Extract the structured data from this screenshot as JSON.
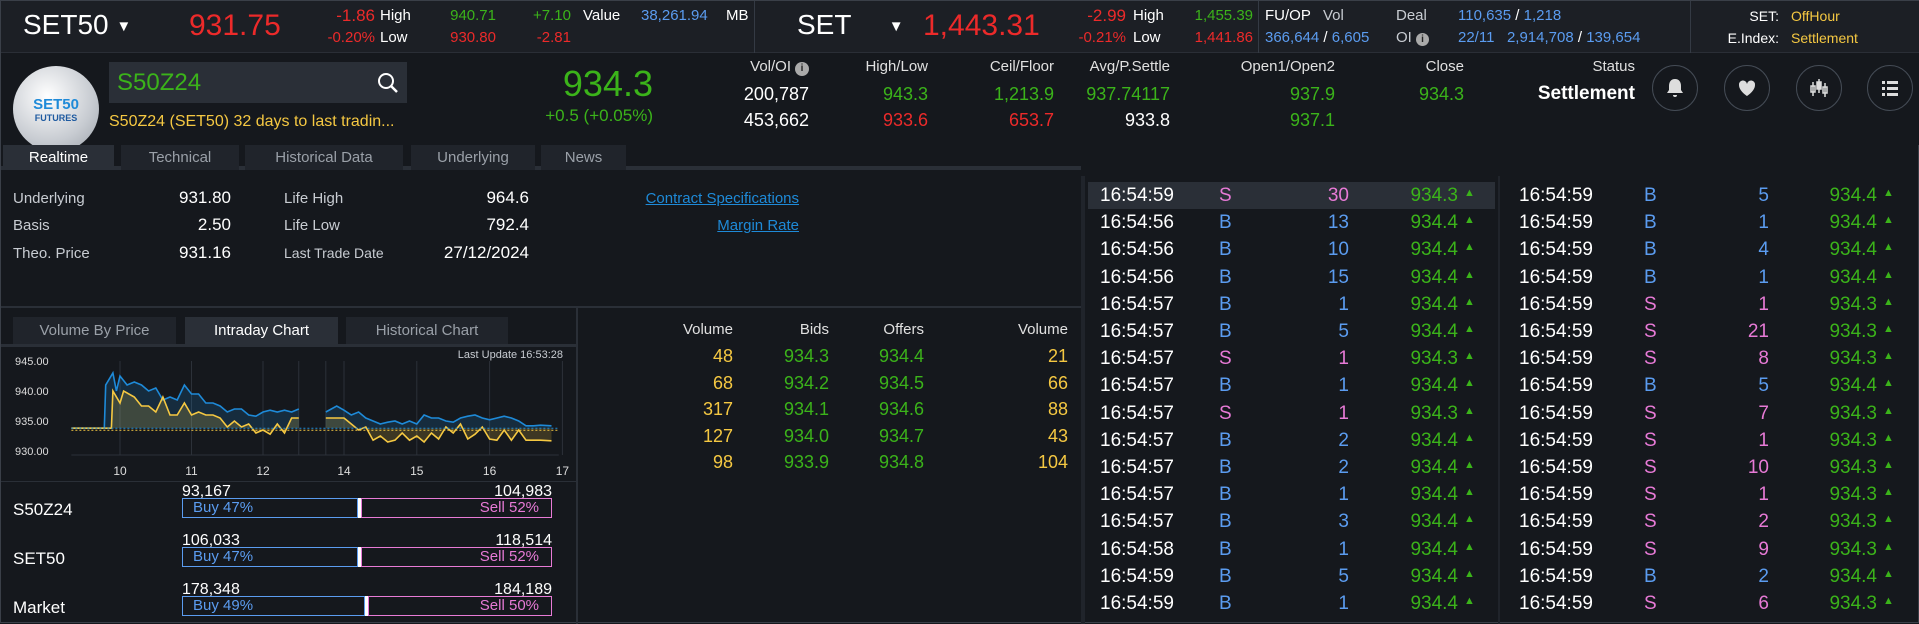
{
  "topbar": {
    "set50": {
      "name": "SET50",
      "last": "931.75",
      "change": "-1.86",
      "pct": "-0.20%",
      "high_label": "High",
      "low_label": "Low",
      "high": "940.71",
      "low": "930.80",
      "high_chg": "+7.10",
      "low_chg": "-2.81",
      "value_label": "Value",
      "value": "38,261.94",
      "unit": "MB"
    },
    "set": {
      "name": "SET",
      "last": "1,443.31",
      "change": "-2.99",
      "pct": "-0.21%",
      "high_label": "High",
      "low_label": "Low",
      "high": "1,455.39",
      "low": "1,441.86"
    },
    "fuop": {
      "label": "FU/OP",
      "vol_label": "Vol",
      "vol": "366,644",
      "vol2": "6,605",
      "deal_label": "Deal",
      "deal": "110,635",
      "deal2": "1,218",
      "oi_label": "OI",
      "oi_date": "22/11",
      "oi": "2,914,708",
      "oi2": "139,654",
      "sep": "/"
    },
    "status": {
      "set_label": "SET:",
      "set_value": "OffHour",
      "eindex_label": "E.Index:",
      "eindex_value": "Settlement"
    }
  },
  "header": {
    "logo_line1": "SET50",
    "logo_line2": "FUTURES",
    "search_value": "S50Z24",
    "description": "S50Z24 (SET50) 32 days to last tradin...",
    "last": "934.3",
    "change": "+0.5 (+0.05%)",
    "columns": [
      {
        "label": "Vol/OI",
        "v1": "200,787",
        "v2": "453,662"
      },
      {
        "label": "High/Low",
        "v1": "943.3",
        "v2": "933.6"
      },
      {
        "label": "Ceil/Floor",
        "v1": "1,213.9",
        "v2": "653.7"
      },
      {
        "label": "Avg/P.Settle",
        "v1": "937.74117",
        "v2": "933.8"
      },
      {
        "label": "Open1/Open2",
        "v1": "937.9",
        "v2": "937.1"
      },
      {
        "label": "Close",
        "v1": "934.3",
        "v2": ""
      },
      {
        "label": "Status",
        "v1": "Settlement",
        "v2": ""
      }
    ],
    "icons": [
      "bell-icon",
      "heart-icon",
      "candlestick-icon",
      "list-icon"
    ]
  },
  "tabs": [
    "Realtime",
    "Technical",
    "Historical Data",
    "Underlying",
    "News"
  ],
  "info": {
    "underlying_label": "Underlying",
    "underlying": "931.80",
    "basis_label": "Basis",
    "basis": "2.50",
    "theo_label": "Theo. Price",
    "theo": "931.16",
    "life_high_label": "Life High",
    "life_high": "964.6",
    "life_low_label": "Life Low",
    "life_low": "792.4",
    "last_trade_label": "Last Trade Date",
    "last_trade": "27/12/2024",
    "contract_spec": "Contract Specifications",
    "margin_rate": "Margin Rate"
  },
  "chart_tabs": [
    "Volume By Price",
    "Intraday Chart",
    "Historical Chart"
  ],
  "chart_data": {
    "type": "line",
    "last_update": "Last Update 16:53:28",
    "ylim": [
      930,
      945
    ],
    "yticks": [
      "945.00",
      "940.00",
      "935.00",
      "930.00"
    ],
    "xticks": [
      "10",
      "11",
      "12",
      "14",
      "15",
      "16",
      "17"
    ],
    "reference": 933.8,
    "colors": [
      "#1e8ad8",
      "#f5c842"
    ],
    "series": [
      {
        "sessions": [
          [
            [
              9.32,
              933.8
            ],
            [
              9.78,
              933.8
            ],
            [
              9.8,
              941
            ],
            [
              9.9,
              943
            ],
            [
              9.95,
              940
            ],
            [
              10.0,
              942.5
            ],
            [
              10.1,
              941
            ],
            [
              10.2,
              941.5
            ],
            [
              10.3,
              941
            ],
            [
              10.4,
              940
            ],
            [
              10.5,
              940.5
            ],
            [
              10.6,
              938.5
            ],
            [
              10.7,
              939
            ],
            [
              10.8,
              938.5
            ],
            [
              10.9,
              941
            ],
            [
              11.0,
              939.5
            ],
            [
              11.1,
              939.5
            ],
            [
              11.2,
              938
            ],
            [
              11.3,
              938
            ],
            [
              11.4,
              937.5
            ],
            [
              11.5,
              936.5
            ],
            [
              11.6,
              937
            ],
            [
              11.7,
              937
            ],
            [
              11.8,
              936
            ],
            [
              11.9,
              935.8
            ],
            [
              12.0,
              936.5
            ],
            [
              12.1,
              936.8
            ],
            [
              12.2,
              936.5
            ],
            [
              12.3,
              936.8
            ],
            [
              12.4,
              936.5
            ],
            [
              12.5,
              937
            ]
          ],
          [
            [
              13.75,
              936.5
            ],
            [
              13.9,
              937.5
            ],
            [
              14.0,
              936.8
            ],
            [
              14.1,
              936
            ],
            [
              14.2,
              936.5
            ],
            [
              14.3,
              935.5
            ],
            [
              14.4,
              935
            ],
            [
              14.5,
              934.5
            ],
            [
              14.6,
              934.8
            ],
            [
              14.7,
              935
            ],
            [
              14.8,
              934.5
            ],
            [
              14.9,
              935
            ],
            [
              15.0,
              934.5
            ],
            [
              15.1,
              936
            ],
            [
              15.2,
              935.5
            ],
            [
              15.3,
              935.5
            ],
            [
              15.4,
              935
            ],
            [
              15.5,
              934.8
            ],
            [
              15.6,
              935.5
            ],
            [
              15.7,
              935.8
            ],
            [
              15.8,
              936
            ],
            [
              15.9,
              935.5
            ],
            [
              16.0,
              935.2
            ],
            [
              16.1,
              935.5
            ],
            [
              16.2,
              935.8
            ],
            [
              16.3,
              935.5
            ],
            [
              16.4,
              935
            ],
            [
              16.5,
              934.2
            ],
            [
              16.6,
              934.2
            ],
            [
              16.7,
              934.3
            ],
            [
              16.85,
              934.2
            ]
          ]
        ]
      },
      {
        "sessions": [
          [
            [
              9.32,
              933.8
            ],
            [
              9.88,
              933.8
            ],
            [
              9.9,
              940
            ],
            [
              10.0,
              938
            ],
            [
              10.05,
              940
            ],
            [
              10.2,
              939
            ],
            [
              10.3,
              937.5
            ],
            [
              10.4,
              937.5
            ],
            [
              10.5,
              936.5
            ],
            [
              10.6,
              939
            ],
            [
              10.7,
              936
            ],
            [
              10.8,
              936
            ],
            [
              10.9,
              938
            ],
            [
              11.0,
              936
            ],
            [
              11.1,
              936.5
            ],
            [
              11.2,
              936
            ],
            [
              11.3,
              936
            ],
            [
              11.4,
              935.5
            ],
            [
              11.5,
              934
            ],
            [
              11.6,
              935
            ],
            [
              11.7,
              934
            ],
            [
              11.8,
              934.5
            ],
            [
              11.9,
              933
            ],
            [
              12.0,
              933.5
            ],
            [
              12.1,
              932.8
            ],
            [
              12.2,
              934.5
            ],
            [
              12.3,
              933
            ],
            [
              12.4,
              935.5
            ],
            [
              12.5,
              935.5
            ]
          ],
          [
            [
              13.75,
              935.5
            ],
            [
              14.0,
              935.5
            ],
            [
              14.1,
              934.5
            ],
            [
              14.2,
              933.5
            ],
            [
              14.3,
              934
            ],
            [
              14.4,
              931.8
            ],
            [
              14.5,
              932.5
            ],
            [
              14.6,
              931.5
            ],
            [
              14.7,
              931.8
            ],
            [
              14.8,
              933
            ],
            [
              14.9,
              931.8
            ],
            [
              15.0,
              932.5
            ],
            [
              15.1,
              931.5
            ],
            [
              15.2,
              933
            ],
            [
              15.3,
              932
            ],
            [
              15.4,
              934
            ],
            [
              15.5,
              933
            ],
            [
              15.6,
              934.5
            ],
            [
              15.7,
              932
            ],
            [
              15.8,
              932.8
            ],
            [
              15.9,
              934
            ],
            [
              16.0,
              932
            ],
            [
              16.1,
              931.8
            ],
            [
              16.2,
              933.5
            ],
            [
              16.3,
              931.8
            ],
            [
              16.4,
              933.5
            ],
            [
              16.5,
              931.8
            ],
            [
              16.7,
              931.8
            ],
            [
              16.85,
              931.7
            ]
          ]
        ]
      }
    ]
  },
  "buysell": [
    {
      "name": "S50Z24",
      "buy_vol": "93,167",
      "sell_vol": "104,983",
      "buy": "Buy 47%",
      "sell": "Sell 52%",
      "buy_pct": 47,
      "sell_pct": 52
    },
    {
      "name": "SET50",
      "buy_vol": "106,033",
      "sell_vol": "118,514",
      "buy": "Buy 47%",
      "sell": "Sell 52%",
      "buy_pct": 47,
      "sell_pct": 52
    },
    {
      "name": "Market",
      "buy_vol": "178,348",
      "sell_vol": "184,189",
      "buy": "Buy 49%",
      "sell": "Sell 50%",
      "buy_pct": 49,
      "sell_pct": 50
    }
  ],
  "bidoffer": {
    "headers": [
      "Volume",
      "Bids",
      "Offers",
      "Volume"
    ],
    "rows": [
      [
        "48",
        "934.3",
        "934.4",
        "21"
      ],
      [
        "68",
        "934.2",
        "934.5",
        "66"
      ],
      [
        "317",
        "934.1",
        "934.6",
        "88"
      ],
      [
        "127",
        "934.0",
        "934.7",
        "43"
      ],
      [
        "98",
        "933.9",
        "934.8",
        "104"
      ]
    ]
  },
  "trades_left": [
    [
      "16:54:59",
      "S",
      "30",
      "934.3"
    ],
    [
      "16:54:56",
      "B",
      "13",
      "934.4"
    ],
    [
      "16:54:56",
      "B",
      "10",
      "934.4"
    ],
    [
      "16:54:56",
      "B",
      "15",
      "934.4"
    ],
    [
      "16:54:57",
      "B",
      "1",
      "934.4"
    ],
    [
      "16:54:57",
      "B",
      "5",
      "934.4"
    ],
    [
      "16:54:57",
      "S",
      "1",
      "934.3"
    ],
    [
      "16:54:57",
      "B",
      "1",
      "934.4"
    ],
    [
      "16:54:57",
      "S",
      "1",
      "934.3"
    ],
    [
      "16:54:57",
      "B",
      "2",
      "934.4"
    ],
    [
      "16:54:57",
      "B",
      "2",
      "934.4"
    ],
    [
      "16:54:57",
      "B",
      "1",
      "934.4"
    ],
    [
      "16:54:57",
      "B",
      "3",
      "934.4"
    ],
    [
      "16:54:58",
      "B",
      "1",
      "934.4"
    ],
    [
      "16:54:59",
      "B",
      "5",
      "934.4"
    ],
    [
      "16:54:59",
      "B",
      "1",
      "934.4"
    ]
  ],
  "trades_right": [
    [
      "16:54:59",
      "B",
      "5",
      "934.4"
    ],
    [
      "16:54:59",
      "B",
      "1",
      "934.4"
    ],
    [
      "16:54:59",
      "B",
      "4",
      "934.4"
    ],
    [
      "16:54:59",
      "B",
      "1",
      "934.4"
    ],
    [
      "16:54:59",
      "S",
      "1",
      "934.3"
    ],
    [
      "16:54:59",
      "S",
      "21",
      "934.3"
    ],
    [
      "16:54:59",
      "S",
      "8",
      "934.3"
    ],
    [
      "16:54:59",
      "B",
      "5",
      "934.4"
    ],
    [
      "16:54:59",
      "S",
      "7",
      "934.3"
    ],
    [
      "16:54:59",
      "S",
      "1",
      "934.3"
    ],
    [
      "16:54:59",
      "S",
      "10",
      "934.3"
    ],
    [
      "16:54:59",
      "S",
      "1",
      "934.3"
    ],
    [
      "16:54:59",
      "S",
      "2",
      "934.3"
    ],
    [
      "16:54:59",
      "S",
      "9",
      "934.3"
    ],
    [
      "16:54:59",
      "B",
      "2",
      "934.4"
    ],
    [
      "16:54:59",
      "S",
      "6",
      "934.3"
    ]
  ]
}
